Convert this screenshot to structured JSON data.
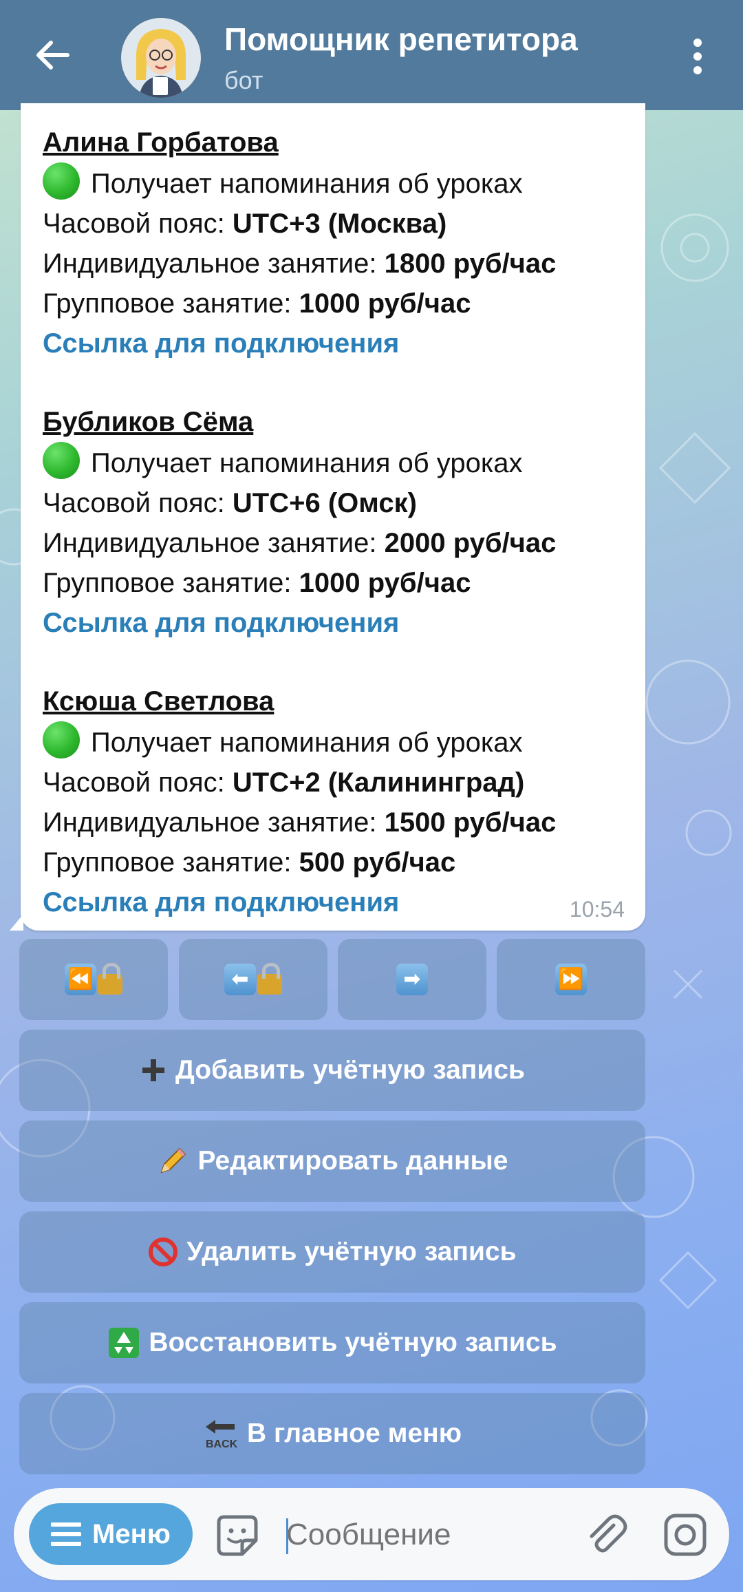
{
  "header": {
    "title": "Помощник репетитора",
    "subtitle": "бот"
  },
  "message": {
    "students": [
      {
        "name": "Алина Горбатова",
        "reminder": "Получает напоминания об уроках",
        "timezone_label": "Часовой пояс: ",
        "timezone_value": "UTC+3 (Москва)",
        "individual_label": "Индивидуальное занятие: ",
        "individual_value": "1800 руб/час",
        "group_label": "Групповое занятие: ",
        "group_value": "1000 руб/час",
        "link": "Ссылка для подключения"
      },
      {
        "name": "Бубликов Сёма",
        "reminder": "Получает напоминания об уроках",
        "timezone_label": "Часовой пояс: ",
        "timezone_value": "UTC+6 (Омск)",
        "individual_label": "Индивидуальное занятие: ",
        "individual_value": "2000 руб/час",
        "group_label": "Групповое занятие: ",
        "group_value": "1000 руб/час",
        "link": "Ссылка для подключения"
      },
      {
        "name": "Ксюша Светлова",
        "reminder": "Получает напоминания об уроках",
        "timezone_label": "Часовой пояс: ",
        "timezone_value": "UTC+2 (Калининград)",
        "individual_label": "Индивидуальное занятие: ",
        "individual_value": "1500 руб/час",
        "group_label": "Групповое занятие: ",
        "group_value": "500 руб/час",
        "link": "Ссылка для подключения"
      }
    ],
    "time": "10:54",
    "reminder_status_color": "#2eb82e",
    "link_color": "#2a7fb8"
  },
  "keyboard": {
    "nav": [
      {
        "icon": "first-page-locked-icon",
        "glyph": "⏪"
      },
      {
        "icon": "prev-page-locked-icon",
        "glyph": "⬅"
      },
      {
        "icon": "next-page-icon",
        "glyph": "➡"
      },
      {
        "icon": "last-page-icon",
        "glyph": "⏩"
      }
    ],
    "buttons": {
      "add": {
        "icon": "plus-icon",
        "label": "Добавить учётную запись"
      },
      "edit": {
        "icon": "pencil-icon",
        "label": "Редактировать данные"
      },
      "delete": {
        "icon": "prohibited-icon",
        "label": "Удалить учётную запись"
      },
      "restore": {
        "icon": "recycle-icon",
        "label": "Восстановить учётную запись"
      },
      "main_menu": {
        "icon": "back-arrow-icon",
        "label": "В главное меню"
      }
    }
  },
  "composer": {
    "menu_label": "Меню",
    "placeholder": "Сообщение"
  },
  "colors": {
    "header_bg": "#527a9c",
    "menu_button_bg": "#55a6dc"
  }
}
